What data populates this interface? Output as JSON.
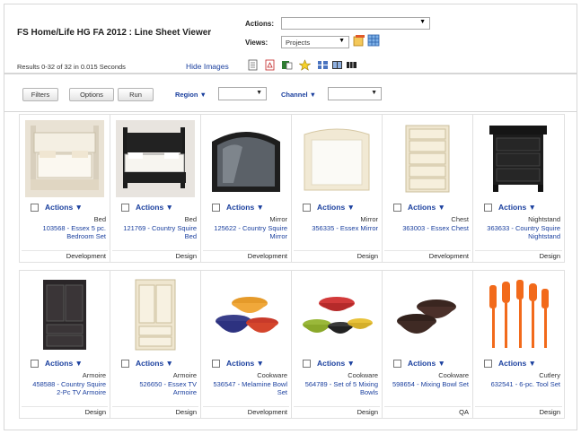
{
  "header": {
    "title": "FS Home/Life HG FA 2012 : Line Sheet Viewer",
    "actions_label": "Actions:",
    "actions_value": "",
    "views_label": "Views:",
    "views_value": "Projects"
  },
  "toolbar": {
    "results_text": "Results 0-32 of 32 in 0.015 Seconds",
    "hide_images": "Hide Images"
  },
  "filters": {
    "filters_btn": "Filters",
    "options_btn": "Options",
    "run_btn": "Run",
    "region_label": "Region",
    "region_value": "",
    "channel_label": "Channel",
    "channel_value": ""
  },
  "products": [
    {
      "actions": "Actions",
      "category": "Bed",
      "link": "103568 - Essex 5 pc. Bedroom Set",
      "status": "Development",
      "image": "white-bed"
    },
    {
      "actions": "Actions",
      "category": "Bed",
      "link": "121769 - Country Squire Bed",
      "status": "Design",
      "image": "black-bed"
    },
    {
      "actions": "Actions",
      "category": "Mirror",
      "link": "125622 - Country Squire Mirror",
      "status": "Development",
      "image": "dark-mirror"
    },
    {
      "actions": "Actions",
      "category": "Mirror",
      "link": "356335 - Essex Mirror",
      "status": "Design",
      "image": "cream-mirror"
    },
    {
      "actions": "Actions",
      "category": "Chest",
      "link": "363003 - Essex Chest",
      "status": "Development",
      "image": "cream-chest"
    },
    {
      "actions": "Actions",
      "category": "Nightstand",
      "link": "363633 - Country Squire Nightstand",
      "status": "Design",
      "image": "black-nightstand"
    },
    {
      "actions": "Actions",
      "category": "Armoire",
      "link": "458588 - Country Squire 2-Pc TV Armoire",
      "status": "Design",
      "image": "dark-armoire"
    },
    {
      "actions": "Actions",
      "category": "Armoire",
      "link": "526650 - Essex TV Armoire",
      "status": "Design",
      "image": "cream-armoire"
    },
    {
      "actions": "Actions",
      "category": "Cookware",
      "link": "536547 - Melamine Bowl Set",
      "status": "Development",
      "image": "melamine-bowls"
    },
    {
      "actions": "Actions",
      "category": "Cookware",
      "link": "564789 - Set of 5 Mixing Bowls",
      "status": "Design",
      "image": "mixing-bowls"
    },
    {
      "actions": "Actions",
      "category": "Cookware",
      "link": "598654 - Mixing Bowl Set",
      "status": "QA",
      "image": "brown-bowls"
    },
    {
      "actions": "Actions",
      "category": "Cutlery",
      "link": "632541 - 6-pc. Tool Set",
      "status": "Design",
      "image": "orange-tools"
    }
  ]
}
